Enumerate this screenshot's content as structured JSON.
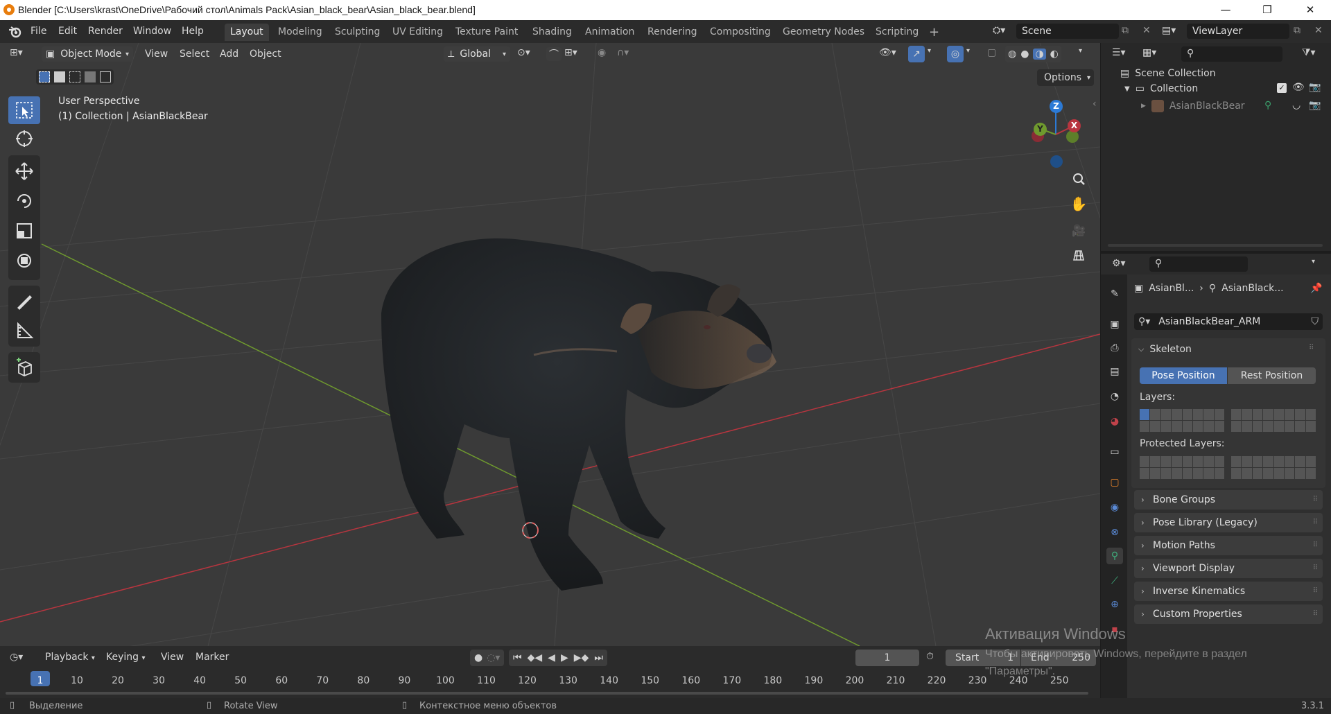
{
  "window": {
    "title": "Blender [C:\\Users\\krast\\OneDrive\\Рабочий стол\\Animals Pack\\Asian_black_bear\\Asian_black_bear.blend]",
    "minimize": "—",
    "maximize": "❐",
    "close": "✕"
  },
  "menu": {
    "file": "File",
    "edit": "Edit",
    "render": "Render",
    "window": "Window",
    "help": "Help"
  },
  "workspaces": [
    "Layout",
    "Modeling",
    "Sculpting",
    "UV Editing",
    "Texture Paint",
    "Shading",
    "Animation",
    "Rendering",
    "Compositing",
    "Geometry Nodes",
    "Scripting"
  ],
  "workspace_add": "+",
  "scene": {
    "name": "Scene"
  },
  "viewlayer": {
    "name": "ViewLayer"
  },
  "viewport_header": {
    "mode": "Object Mode",
    "view": "View",
    "select": "Select",
    "add": "Add",
    "object": "Object",
    "orientation": "Global",
    "options": "Options"
  },
  "viewport": {
    "perspective": "User Perspective",
    "collection_info": "(1) Collection | AsianBlackBear",
    "gizmo": {
      "z": "Z",
      "y": "Y",
      "x": "X"
    }
  },
  "outliner": {
    "scene_collection": "Scene Collection",
    "collection": "Collection",
    "object": "AsianBlackBear"
  },
  "properties": {
    "breadcrumb_object": "AsianBl...",
    "breadcrumb_data": "AsianBlack...",
    "armature_name": "AsianBlackBear_ARM",
    "skeleton": "Skeleton",
    "pose_position": "Pose Position",
    "rest_position": "Rest Position",
    "layers": "Layers:",
    "protected_layers": "Protected Layers:",
    "sections": [
      "Bone Groups",
      "Pose Library (Legacy)",
      "Motion Paths",
      "Viewport Display",
      "Inverse Kinematics",
      "Custom Properties"
    ]
  },
  "timeline": {
    "playback": "Playback",
    "keying": "Keying",
    "view": "View",
    "marker": "Marker",
    "current_frame": "1",
    "start_label": "Start",
    "start_value": "1",
    "end_label": "End",
    "end_value": "250",
    "frames": [
      "1",
      "10",
      "20",
      "30",
      "40",
      "50",
      "60",
      "70",
      "80",
      "90",
      "100",
      "110",
      "120",
      "130",
      "140",
      "150",
      "160",
      "170",
      "180",
      "190",
      "200",
      "210",
      "220",
      "230",
      "240",
      "250"
    ]
  },
  "status": {
    "select": "Выделение",
    "rotate": "Rotate View",
    "context": "Контекстное меню объектов",
    "version": "3.3.1"
  },
  "watermark": {
    "line1": "Активация Windows",
    "line2": "Чтобы активировать Windows, перейдите в раздел",
    "line3": "\"Параметры\"."
  },
  "colors": {
    "accent": "#4772b3",
    "axis_x": "#b8353f",
    "axis_y": "#6f9a2e",
    "axis_z": "#2c7ad6"
  }
}
